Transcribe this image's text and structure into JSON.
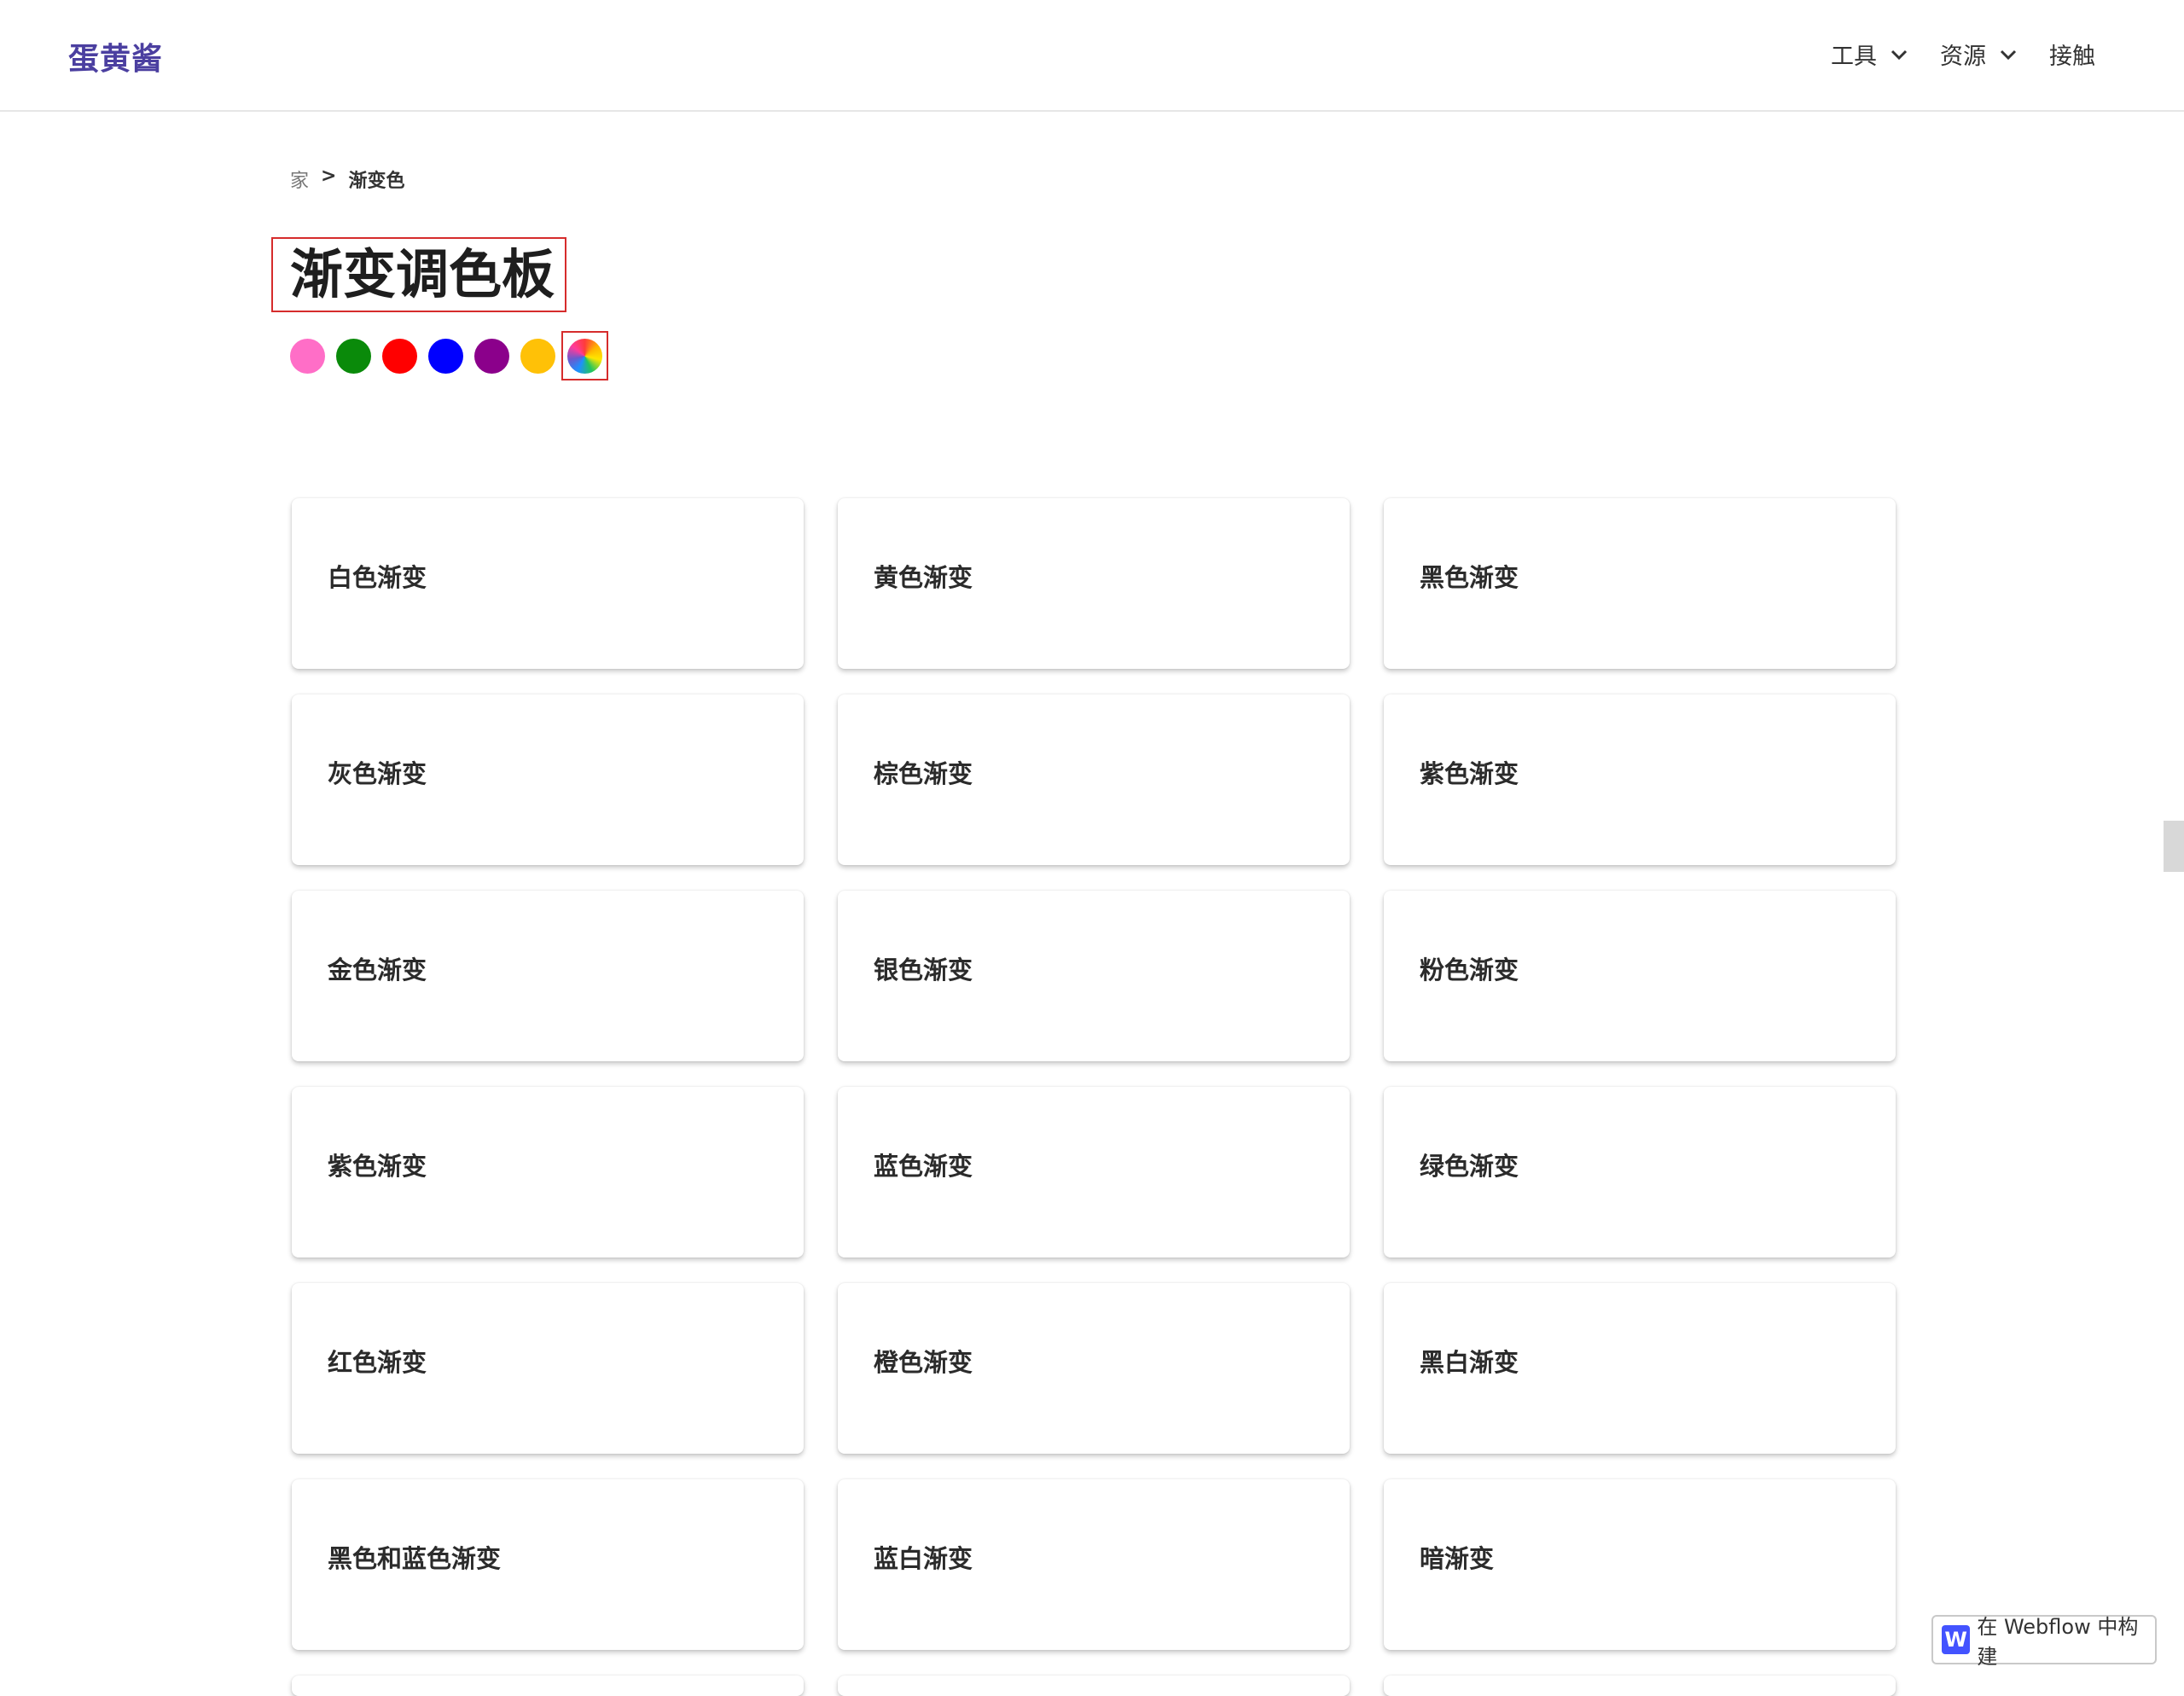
{
  "nav": {
    "brand": "蛋黄酱",
    "items": [
      {
        "label": "工具",
        "has_dropdown": true
      },
      {
        "label": "资源",
        "has_dropdown": true
      },
      {
        "label": "接触",
        "has_dropdown": false
      }
    ]
  },
  "breadcrumb": {
    "home": "家",
    "separator": ">",
    "current": "渐变色"
  },
  "page_title": "渐变调色板",
  "swatches": {
    "colors": [
      "#ff6ec7",
      "#0a8a0a",
      "#ff0000",
      "#0000ff",
      "#8b008b",
      "#ffc107"
    ],
    "multicolor_icon": "rainbow-wheel-icon"
  },
  "cards": [
    "白色渐变",
    "黄色渐变",
    "黑色渐变",
    "灰色渐变",
    "棕色渐变",
    "紫色渐变",
    "金色渐变",
    "银色渐变",
    "粉色渐变",
    "紫色渐变",
    "蓝色渐变",
    "绿色渐变",
    "红色渐变",
    "橙色渐变",
    "黑白渐变",
    "黑色和蓝色渐变",
    "蓝白渐变",
    "暗渐变"
  ],
  "webflow_badge": {
    "logo": "W",
    "text": "在 Webflow 中构建"
  }
}
